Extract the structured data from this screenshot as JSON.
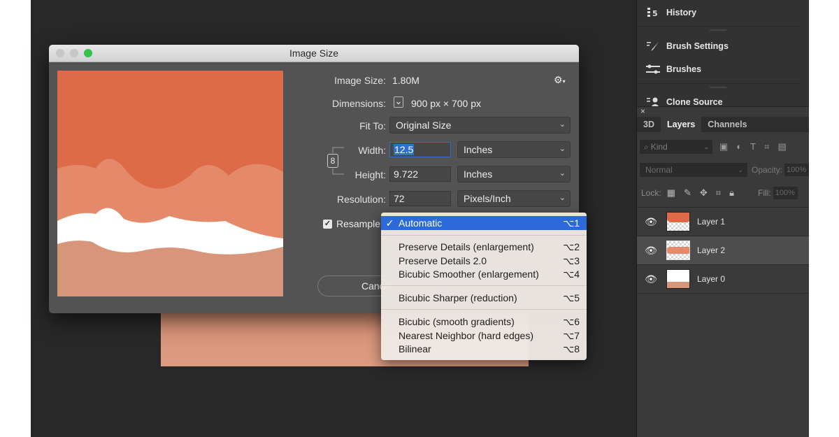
{
  "dialog": {
    "title": "Image Size",
    "image_size_label": "Image Size:",
    "image_size_value": "1.80M",
    "dimensions_label": "Dimensions:",
    "dimensions_value": "900 px  ×  700 px",
    "fit_to_label": "Fit To:",
    "fit_to_value": "Original Size",
    "width_label": "Width:",
    "width_value": "12.5",
    "width_unit": "Inches",
    "height_label": "Height:",
    "height_value": "9.722",
    "height_unit": "Inches",
    "resolution_label": "Resolution:",
    "resolution_value": "72",
    "resolution_unit": "Pixels/Inch",
    "resample_label": "Resample",
    "resample_checked": true,
    "cancel_label": "Cancel"
  },
  "resample_menu": {
    "items": [
      {
        "label": "Automatic",
        "shortcut": "⌥1",
        "checked": true
      },
      {
        "label": "Preserve Details (enlargement)",
        "shortcut": "⌥2"
      },
      {
        "label": "Preserve Details 2.0",
        "shortcut": "⌥3"
      },
      {
        "label": "Bicubic Smoother (enlargement)",
        "shortcut": "⌥4"
      },
      {
        "label": "Bicubic Sharper (reduction)",
        "shortcut": "⌥5"
      },
      {
        "label": "Bicubic (smooth gradients)",
        "shortcut": "⌥6"
      },
      {
        "label": "Nearest Neighbor (hard edges)",
        "shortcut": "⌥7"
      },
      {
        "label": "Bilinear",
        "shortcut": "⌥8"
      }
    ]
  },
  "panels": {
    "history": "History",
    "brush_settings": "Brush Settings",
    "brushes": "Brushes",
    "clone_source": "Clone Source"
  },
  "layers_panel": {
    "tabs": [
      "3D",
      "Layers",
      "Channels"
    ],
    "active_tab": "Layers",
    "kind_placeholder": "Kind",
    "blend_mode": "Normal",
    "opacity_label": "Opacity:",
    "opacity_value": "100%",
    "lock_label": "Lock:",
    "fill_label": "Fill:",
    "fill_value": "100%",
    "layers": [
      {
        "name": "Layer 1",
        "visible": true
      },
      {
        "name": "Layer 2",
        "visible": true,
        "selected": true
      },
      {
        "name": "Layer 0",
        "visible": true
      }
    ]
  },
  "colors": {
    "accent_blue": "#2b6ad8",
    "preview_orange": "#dd6b47",
    "preview_salmon": "#e48a6a",
    "preview_tan": "#d7957a"
  }
}
